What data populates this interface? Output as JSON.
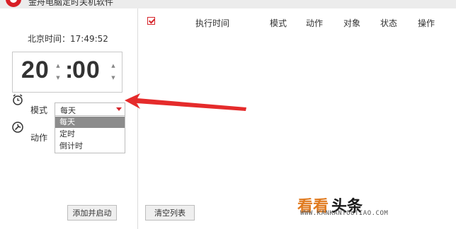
{
  "titlebar": {
    "title": "金舟电脑定时关机软件"
  },
  "clock": {
    "text": "北京时间：17:49:52"
  },
  "timer": {
    "hour": "20",
    "colon": ":",
    "minute": "00",
    "up_glyph": "▲",
    "down_glyph": "▼"
  },
  "mode": {
    "label": "模式",
    "selected": "每天",
    "options": [
      "每天",
      "定时",
      "倒计时"
    ]
  },
  "action": {
    "label": "动作"
  },
  "buttons": {
    "add_start": "添加并启动",
    "clear_list": "清空列表"
  },
  "table": {
    "headers": [
      "执行时间",
      "模式",
      "动作",
      "对象",
      "状态",
      "操作"
    ]
  },
  "watermark": {
    "brand_a": "看看",
    "brand_b": "头条",
    "url": "WWW.KANKANTOUTIAO.COM"
  },
  "colors": {
    "accent": "#d6262c",
    "arrow": "#e52b2b",
    "watermark_orange": "#e07a1f"
  },
  "icons": {
    "mode_icon": "alarm-clock-icon",
    "action_icon": "wrench-icon"
  }
}
